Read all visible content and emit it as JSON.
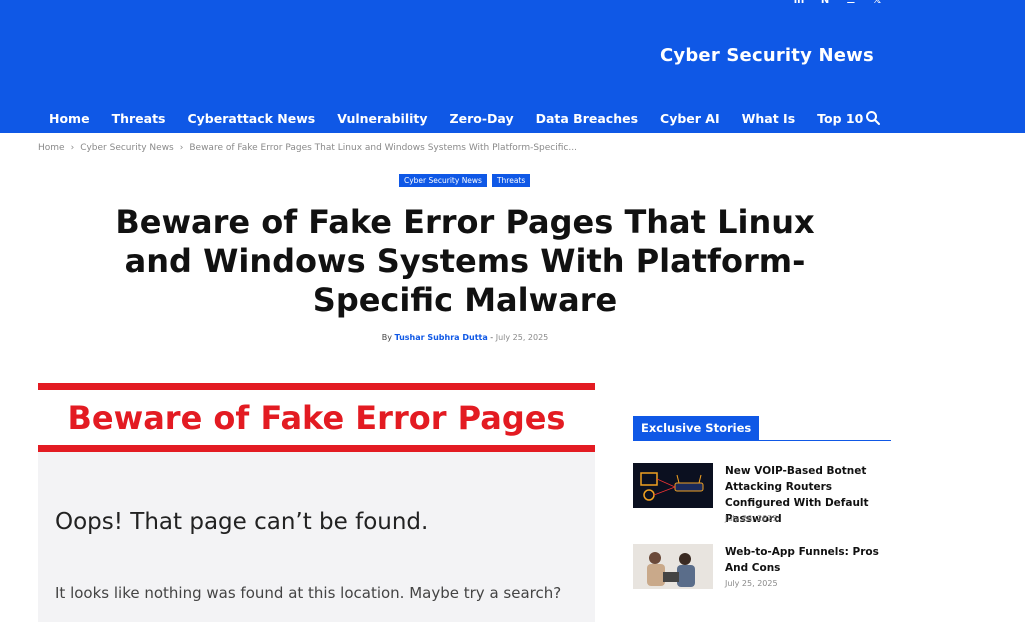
{
  "header": {
    "logo_text": "Cyber Security News",
    "social": [
      "linkedin-icon",
      "news-icon",
      "rss-icon",
      "x-icon"
    ],
    "brand_color": "#0f58e6"
  },
  "nav": {
    "items": [
      {
        "label": "Home"
      },
      {
        "label": "Threats"
      },
      {
        "label": "Cyberattack News"
      },
      {
        "label": "Vulnerability"
      },
      {
        "label": "Zero-Day"
      },
      {
        "label": "Data Breaches"
      },
      {
        "label": "Cyber AI"
      },
      {
        "label": "What Is"
      },
      {
        "label": "Top 10"
      }
    ],
    "search_icon": "search-icon"
  },
  "breadcrumb": {
    "home": "Home",
    "category": "Cyber Security News",
    "current": "Beware of Fake Error Pages That Linux and Windows Systems With Platform-Specific..."
  },
  "article": {
    "categories": [
      "Cyber Security News",
      "Threats"
    ],
    "title": "Beware of Fake Error Pages That Linux and Windows Systems With Platform-Specific Malware",
    "by_label": "By",
    "author": "Tushar Subhra Dutta",
    "separator": "-",
    "date": "July 25, 2025"
  },
  "hero": {
    "banner_text": "Beware of Fake Error Pages",
    "oops_text": "Oops! That page can’t be found.",
    "nothing_text": "It looks like nothing was found at this location. Maybe try a search?",
    "accent_color": "#e31b22"
  },
  "sidebar": {
    "heading": "Exclusive Stories",
    "stories": [
      {
        "title": "New VOIP-Based Botnet Attacking Routers Configured With Default Password",
        "date": "July 26, 2025"
      },
      {
        "title": "Web-to-App Funnels: Pros And Cons",
        "date": "July 25, 2025"
      }
    ]
  }
}
